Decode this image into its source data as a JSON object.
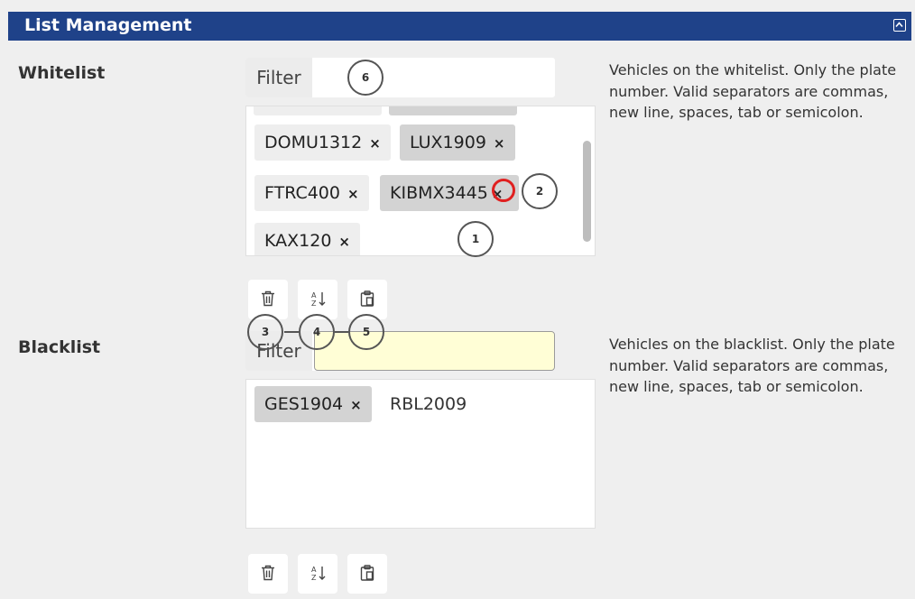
{
  "header": {
    "title": "List Management"
  },
  "whitelist": {
    "label": "Whitelist",
    "filter_label": "Filter",
    "filter_value": "",
    "description": "Vehicles on the whitelist. Only the plate number. Valid separators are commas, new line, spaces, tab or semicolon.",
    "tags": [
      {
        "text": "DOMU1312",
        "remove": "×"
      },
      {
        "text": "LUX1909",
        "remove": "×"
      },
      {
        "text": "FTRC400",
        "remove": "×"
      },
      {
        "text": "KIBMX3445",
        "remove": "×"
      },
      {
        "text": "KAX120",
        "remove": "×"
      }
    ]
  },
  "blacklist": {
    "label": "Blacklist",
    "filter_label": "Filter",
    "filter_value": "",
    "description": "Vehicles on the blacklist. Only the plate number. Valid separators are commas, new line, spaces, tab or semicolon.",
    "tags": [
      {
        "text": "GES1904",
        "remove": "×"
      }
    ],
    "draft_text": "RBL2009"
  },
  "toolbar_icons": [
    "trash-icon",
    "sort-alpha-icon",
    "paste-icon"
  ],
  "callouts": [
    "1",
    "2",
    "3",
    "4",
    "5",
    "6"
  ],
  "colors": {
    "header_bg": "#1f4289",
    "highlight_ring": "#e02020",
    "filter_highlight": "#fffed6"
  }
}
